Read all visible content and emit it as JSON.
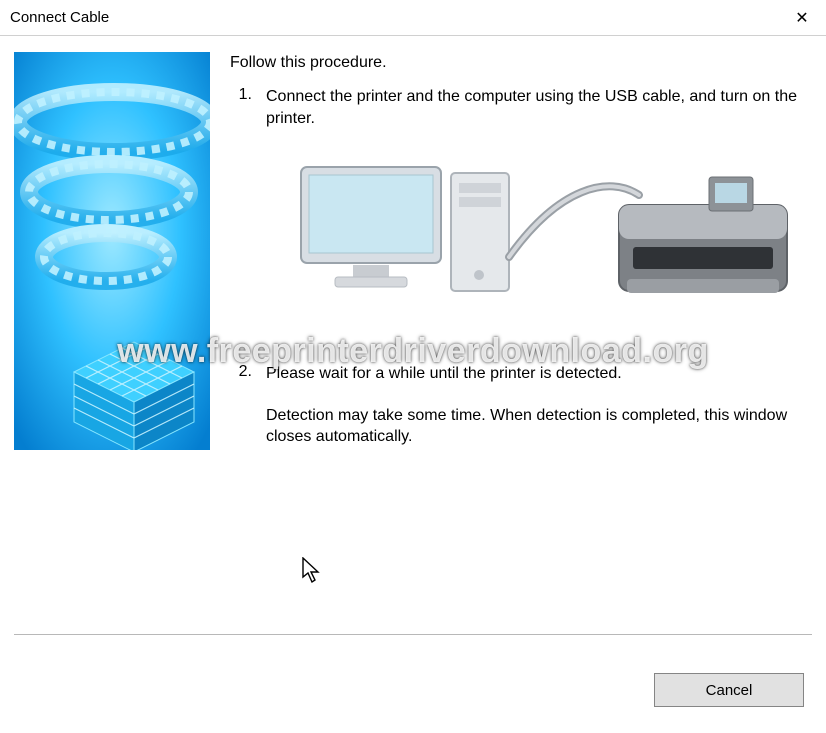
{
  "window": {
    "title": "Connect Cable",
    "close_label": "✕"
  },
  "content": {
    "intro": "Follow this procedure.",
    "steps": [
      {
        "num": "1.",
        "text": "Connect the printer and the computer using the USB cable, and turn on the printer."
      },
      {
        "num": "2.",
        "text": "Please wait for a while until the printer is detected."
      }
    ],
    "note": "Detection may take some time. When detection is completed, this window closes automatically."
  },
  "footer": {
    "cancel_label": "Cancel"
  },
  "watermark": "www.freeprinterdriverdownload.org"
}
